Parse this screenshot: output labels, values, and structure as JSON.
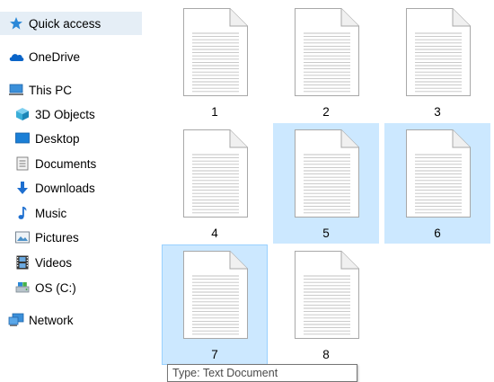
{
  "nav": {
    "items": [
      {
        "label": "Quick access",
        "icon": "star-icon",
        "level": 0,
        "selected": true
      },
      {
        "label": "OneDrive",
        "icon": "cloud-icon",
        "level": 0
      },
      {
        "label": "This PC",
        "icon": "computer-icon",
        "level": 0
      },
      {
        "label": "3D Objects",
        "icon": "cube-icon",
        "level": 1
      },
      {
        "label": "Desktop",
        "icon": "desktop-icon",
        "level": 1
      },
      {
        "label": "Documents",
        "icon": "documents-icon",
        "level": 1
      },
      {
        "label": "Downloads",
        "icon": "download-arrow-icon",
        "level": 1
      },
      {
        "label": "Music",
        "icon": "music-note-icon",
        "level": 1
      },
      {
        "label": "Pictures",
        "icon": "pictures-icon",
        "level": 1
      },
      {
        "label": "Videos",
        "icon": "film-icon",
        "level": 1
      },
      {
        "label": "OS (C:)",
        "icon": "drive-icon",
        "level": 1
      },
      {
        "label": "Network",
        "icon": "network-icon",
        "level": 0
      }
    ]
  },
  "files": [
    {
      "name": "1",
      "selected": false
    },
    {
      "name": "2",
      "selected": false
    },
    {
      "name": "3",
      "selected": false
    },
    {
      "name": "4",
      "selected": false
    },
    {
      "name": "5",
      "selected": true
    },
    {
      "name": "6",
      "selected": true
    },
    {
      "name": "7",
      "selected": true,
      "hovered": true
    },
    {
      "name": "8",
      "selected": false
    }
  ],
  "tooltip": {
    "text": "Type: Text Document"
  },
  "colors": {
    "selection": "#cce8ff",
    "selection_border": "#99d1ff",
    "nav_selected": "#e5eef6",
    "accent": "#0078d7"
  }
}
